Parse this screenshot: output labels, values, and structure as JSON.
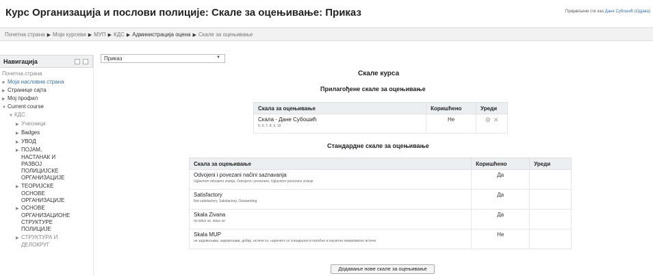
{
  "header": {
    "title": "Курс Организација и послови полиције: Скале за оцењивање: Приказ",
    "login_prefix": "Пријављени сте као",
    "login_user": "Дане Субошић (Одјава)"
  },
  "breadcrumb": [
    "Почетна страна",
    "Моји курсеви",
    "МУП",
    "КДС",
    "Администрација оцена",
    "Скале за оцењивање"
  ],
  "navigation": {
    "title": "Навигација",
    "items": {
      "home": "Почетна страна",
      "my_home": "Моја насловна страна",
      "site_pages": "Странице сајта",
      "my_profile": "Мој профил",
      "current_course": "Current course",
      "kds": "КДС",
      "participants": "Учесници",
      "badges": "Badges",
      "uvod": "УВОД",
      "pojam_1": "ПОЈАМ,",
      "pojam_2": "НАСТАНАК И",
      "pojam_3": "РАЗВОЈ",
      "pojam_4": "ПОЛИЦИЈСКЕ",
      "pojam_5": "ОРГАНИЗАЦИЈЕ",
      "teorijske_1": "ТЕОРИЈСКЕ",
      "teorijske_2": "ОСНОВЕ",
      "teorijske_3": "ОРГАНИЗАЦИЈЕ",
      "osnove_1": "ОСНОВЕ",
      "osnove_2": "ОРГАНИЗАЦИОНЕ",
      "osnove_3": "СТРУКТУРЕ",
      "osnove_4": "ПОЛИЦИЈЕ",
      "struktura_1": "СТРУКТУРА И",
      "struktura_2": "ДЕЛОКРУГ"
    }
  },
  "view_select": {
    "value": "Приказ"
  },
  "main": {
    "heading": "Скале курса",
    "custom_heading": "Прилагођене скале за оцењивање",
    "standard_heading": "Стандардне скале за оцењивање",
    "columns": {
      "scale": "Скала за оцењивање",
      "used": "Коришћено",
      "edit": "Уреди"
    },
    "custom_rows": [
      {
        "name": "Скала - Дане Субошић",
        "items": "5, 6, 7, 8, 9, 10",
        "used": "Не"
      }
    ],
    "standard_rows": [
      {
        "name": "Odvojeni i povezani načini saznavanja",
        "items": "Uglavnom odvojeno znanje, Odvojeno i povezano, Uglavnom povezano znanje",
        "used": "Да"
      },
      {
        "name": "Satisfactory",
        "items": "Not satisfactory, Satisfactory, Outstanding",
        "used": "Да"
      },
      {
        "name": "Skala Zivana",
        "items": "ne istice se, istice se",
        "used": "Да"
      },
      {
        "name": "Skala MUP",
        "items": "не задовољава, задовољава, добар, истиче се, нарочито се специјално и посебно и изузетно невероватно истиче",
        "used": "Не"
      }
    ],
    "add_button": "Додавање нове скале за оцењивање"
  }
}
